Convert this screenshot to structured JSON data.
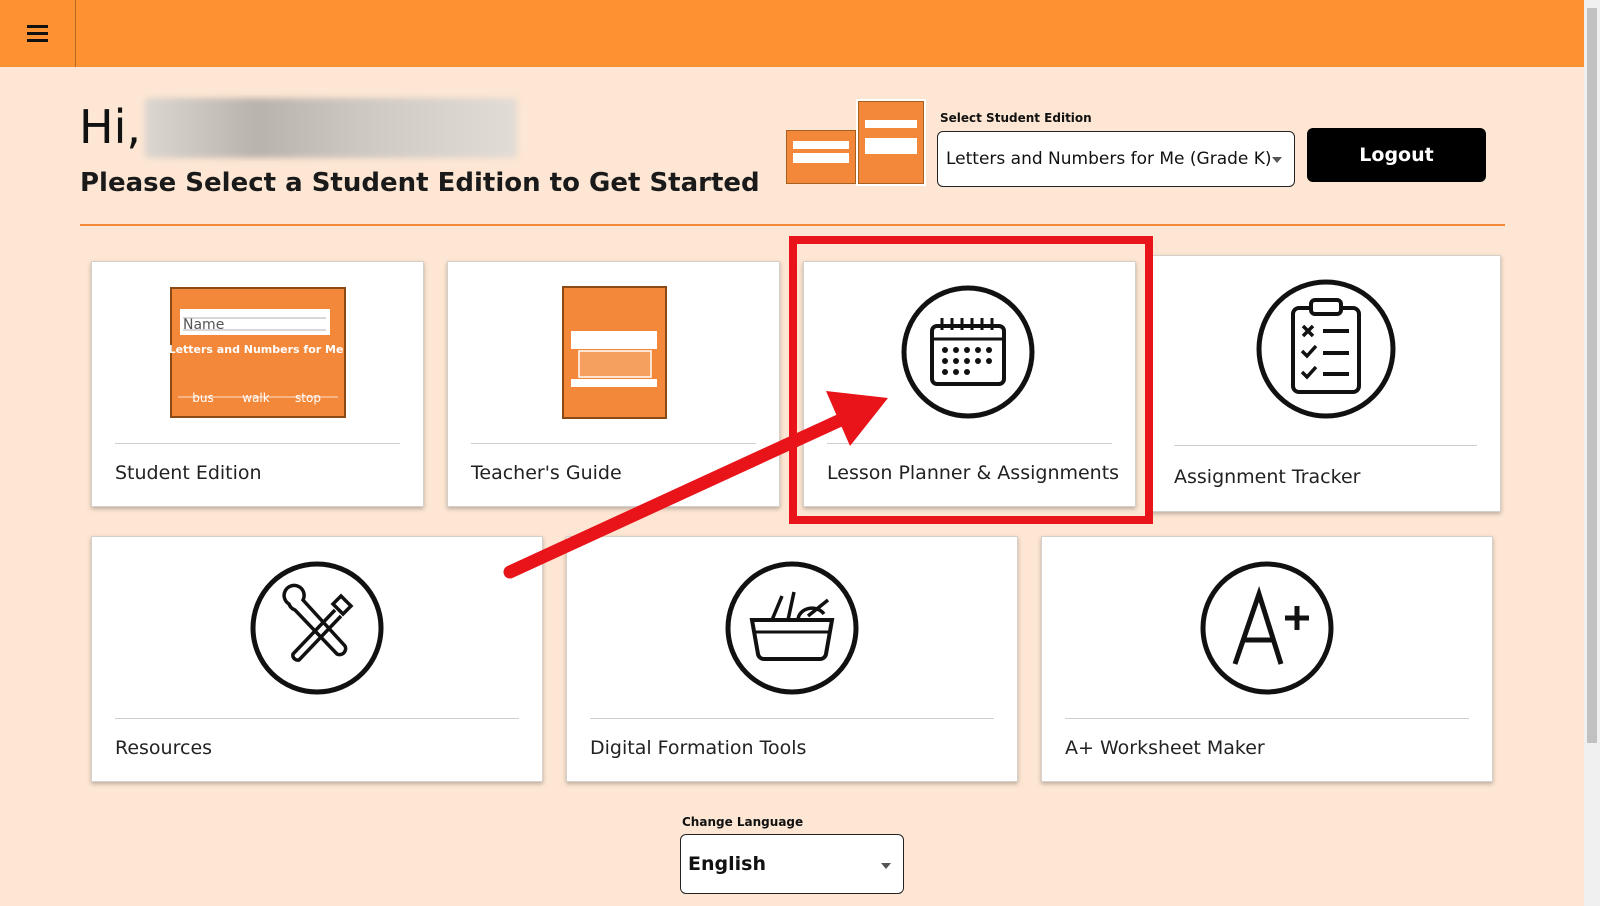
{
  "header": {
    "menu_icon": "hamburger-menu-icon",
    "bar_color": "#fe9233"
  },
  "greeting": {
    "hi": "Hi,",
    "subtitle": "Please Select a Student Edition to Get Started"
  },
  "edition_select": {
    "label": "Select Student Edition",
    "value": "Letters and Numbers for Me (Grade K)"
  },
  "logout_label": "Logout",
  "cards": [
    {
      "label": "Student Edition",
      "icon": "student-edition-book-cover"
    },
    {
      "label": "Teacher's Guide",
      "icon": "teachers-guide-book-cover"
    },
    {
      "label": "Lesson Planner & Assignments",
      "icon": "calendar-icon"
    },
    {
      "label": "Assignment Tracker",
      "icon": "clipboard-checklist-icon"
    },
    {
      "label": "Resources",
      "icon": "tools-icon"
    },
    {
      "label": "Digital Formation Tools",
      "icon": "supply-basket-icon"
    },
    {
      "label": "A+ Worksheet Maker",
      "icon": "a-plus-icon"
    }
  ],
  "book": {
    "title": "Letters and Numbers for Me",
    "name_field": "Name",
    "words": [
      "bus",
      "walk",
      "stop"
    ]
  },
  "language": {
    "label": "Change Language",
    "value": "English"
  },
  "annotation_color": "#e8141a"
}
